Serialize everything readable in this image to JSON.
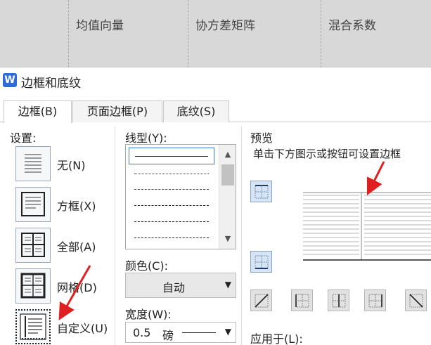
{
  "document_table": {
    "headers": [
      "均值向量",
      "协方差矩阵",
      "混合系数"
    ]
  },
  "dialog": {
    "app_icon_letter": "W",
    "title": "边框和底纹"
  },
  "tabs": [
    {
      "label": "边框(B)",
      "active": true
    },
    {
      "label": "页面边框(P)",
      "active": false
    },
    {
      "label": "底纹(S)",
      "active": false
    }
  ],
  "settings": {
    "label": "设置:",
    "items": [
      {
        "label": "无(N)",
        "icon": "border-none-icon",
        "selected": false
      },
      {
        "label": "方框(X)",
        "icon": "border-box-icon",
        "selected": false
      },
      {
        "label": "全部(A)",
        "icon": "border-all-icon",
        "selected": false
      },
      {
        "label": "网格(D)",
        "icon": "border-grid-icon",
        "selected": false
      },
      {
        "label": "自定义(U)",
        "icon": "border-custom-icon",
        "selected": true
      }
    ]
  },
  "line_style": {
    "label": "线型(Y):",
    "options": [
      "solid",
      "dotted",
      "dashed",
      "dash-dot",
      "long-dash",
      "dash-dot-dot"
    ],
    "selected": "solid"
  },
  "color": {
    "label": "颜色(C):",
    "value": "自动"
  },
  "width": {
    "label": "宽度(W):",
    "value": "0.5",
    "unit": "磅"
  },
  "preview": {
    "label": "预览",
    "hint": "单击下方图示或按钮可设置边框"
  },
  "apply_to": {
    "label": "应用于(L):"
  },
  "colors": {
    "accent": "#2f6bd8",
    "arrow": "#e02020",
    "preview_button_bg": "#d6e4f7"
  }
}
